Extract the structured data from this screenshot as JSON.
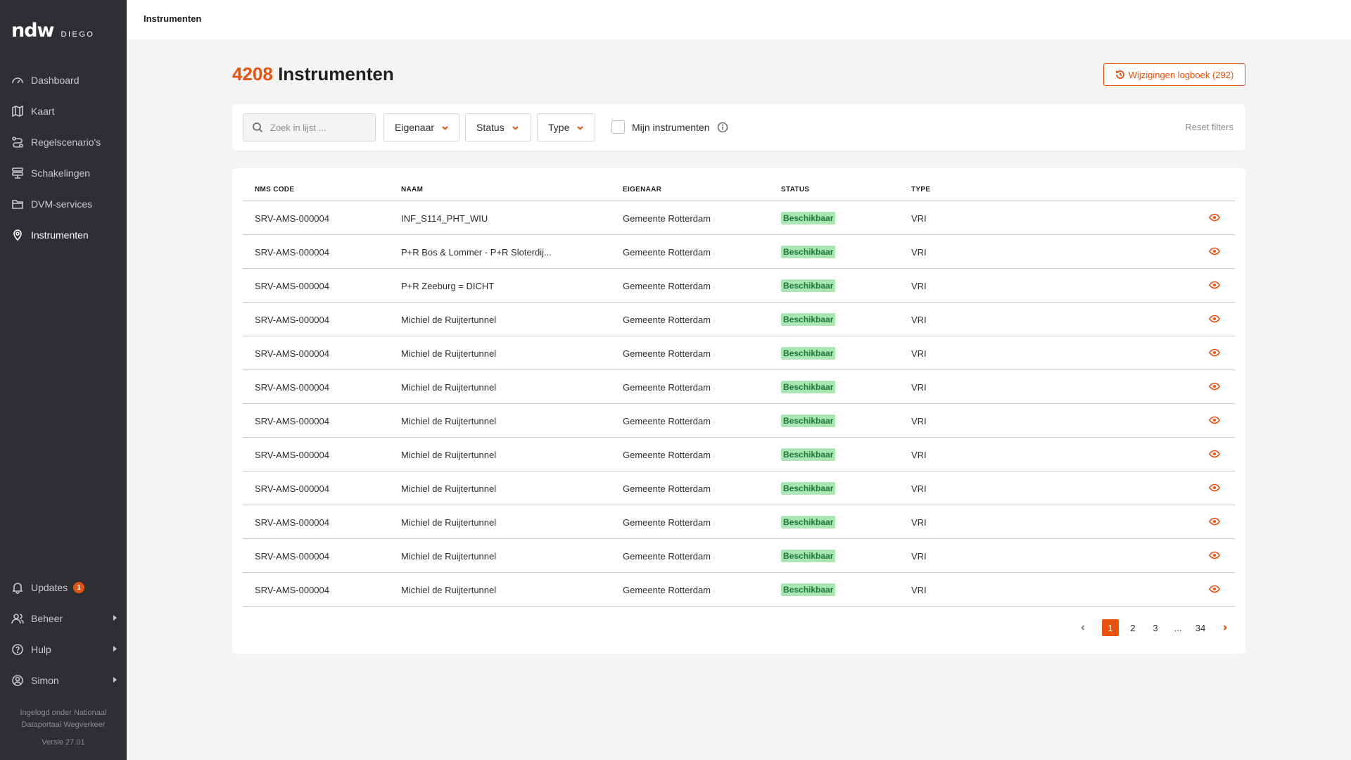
{
  "sidebar": {
    "logo": "ndw",
    "logo_sub": "DIEGO",
    "nav": [
      {
        "label": "Dashboard",
        "icon": "dashboard-icon"
      },
      {
        "label": "Kaart",
        "icon": "map-icon"
      },
      {
        "label": "Regelscenario's",
        "icon": "scenario-icon"
      },
      {
        "label": "Schakelingen",
        "icon": "switch-icon"
      },
      {
        "label": "DVM-services",
        "icon": "folder-icon"
      },
      {
        "label": "Instrumenten",
        "icon": "location-pin-icon"
      }
    ],
    "bottom": [
      {
        "label": "Updates",
        "icon": "bell-icon",
        "badge": "1"
      },
      {
        "label": "Beheer",
        "icon": "users-icon"
      },
      {
        "label": "Hulp",
        "icon": "help-icon"
      },
      {
        "label": "Simon",
        "icon": "user-icon"
      }
    ],
    "footer": {
      "line1": "Ingelogd onder Nationaal",
      "line2": "Dataportaal Wegverkeer",
      "version": "Versie 27.01"
    }
  },
  "topbar": {
    "breadcrumb": "Instrumenten"
  },
  "header": {
    "count": "4208",
    "title": "Instrumenten",
    "log_button": "Wijzigingen logboek (292)"
  },
  "filters": {
    "search_placeholder": "Zoek in lijst ...",
    "owner": "Eigenaar",
    "status": "Status",
    "type": "Type",
    "mine": "Mijn instrumenten",
    "reset": "Reset filters"
  },
  "table": {
    "columns": [
      "NMS CODE",
      "NAAM",
      "EIGENAAR",
      "STATUS",
      "TYPE"
    ],
    "rows": [
      {
        "code": "SRV-AMS-000004",
        "name": "INF_S114_PHT_WIU",
        "owner": "Gemeente Rotterdam",
        "status": "Beschikbaar",
        "type": "VRI"
      },
      {
        "code": "SRV-AMS-000004",
        "name": "P+R Bos & Lommer - P+R Sloterdij...",
        "owner": "Gemeente Rotterdam",
        "status": "Beschikbaar",
        "type": "VRI"
      },
      {
        "code": "SRV-AMS-000004",
        "name": "P+R Zeeburg = DICHT",
        "owner": "Gemeente Rotterdam",
        "status": "Beschikbaar",
        "type": "VRI"
      },
      {
        "code": "SRV-AMS-000004",
        "name": "Michiel de Ruijtertunnel",
        "owner": "Gemeente Rotterdam",
        "status": "Beschikbaar",
        "type": "VRI"
      },
      {
        "code": "SRV-AMS-000004",
        "name": "Michiel de Ruijtertunnel",
        "owner": "Gemeente Rotterdam",
        "status": "Beschikbaar",
        "type": "VRI"
      },
      {
        "code": "SRV-AMS-000004",
        "name": "Michiel de Ruijtertunnel",
        "owner": "Gemeente Rotterdam",
        "status": "Beschikbaar",
        "type": "VRI"
      },
      {
        "code": "SRV-AMS-000004",
        "name": "Michiel de Ruijtertunnel",
        "owner": "Gemeente Rotterdam",
        "status": "Beschikbaar",
        "type": "VRI"
      },
      {
        "code": "SRV-AMS-000004",
        "name": "Michiel de Ruijtertunnel",
        "owner": "Gemeente Rotterdam",
        "status": "Beschikbaar",
        "type": "VRI"
      },
      {
        "code": "SRV-AMS-000004",
        "name": "Michiel de Ruijtertunnel",
        "owner": "Gemeente Rotterdam",
        "status": "Beschikbaar",
        "type": "VRI"
      },
      {
        "code": "SRV-AMS-000004",
        "name": "Michiel de Ruijtertunnel",
        "owner": "Gemeente Rotterdam",
        "status": "Beschikbaar",
        "type": "VRI"
      },
      {
        "code": "SRV-AMS-000004",
        "name": "Michiel de Ruijtertunnel",
        "owner": "Gemeente Rotterdam",
        "status": "Beschikbaar",
        "type": "VRI"
      },
      {
        "code": "SRV-AMS-000004",
        "name": "Michiel de Ruijtertunnel",
        "owner": "Gemeente Rotterdam",
        "status": "Beschikbaar",
        "type": "VRI"
      }
    ]
  },
  "pagination": {
    "pages": [
      "1",
      "2",
      "3",
      "...",
      "34"
    ],
    "current": "1"
  },
  "colors": {
    "accent": "#e8520e",
    "sidebar_bg": "#2d2f33",
    "status_bg": "#a8e6b4",
    "status_text": "#1f7a35"
  }
}
